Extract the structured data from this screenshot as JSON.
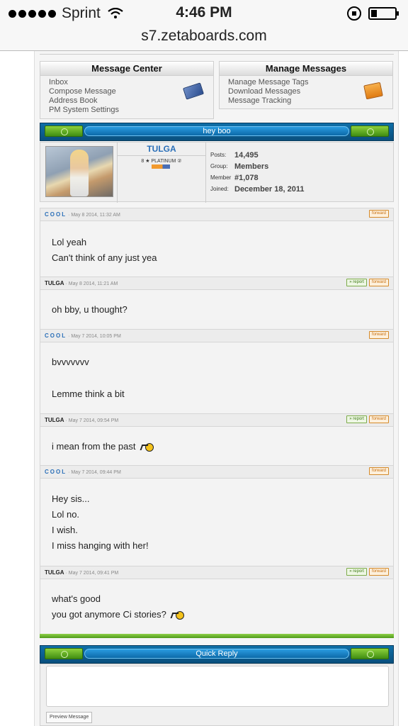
{
  "status_bar": {
    "carrier": "Sprint",
    "time": "4:46 PM"
  },
  "address_bar": {
    "url": "s7.zetaboards.com"
  },
  "message_center": {
    "title": "Message Center",
    "items": [
      "Inbox",
      "Compose Message",
      "Address Book",
      "PM System Settings"
    ],
    "icon": "envelope-icon"
  },
  "manage_messages": {
    "title": "Manage Messages",
    "items": [
      "Manage Message Tags",
      "Download Messages",
      "Message Tracking"
    ],
    "icon": "folder-icon"
  },
  "thread": {
    "title": "hey boo"
  },
  "profile": {
    "name": "TULGA",
    "rank": "8 ★ PLATINUM ②",
    "stats": [
      {
        "label": "Posts:",
        "value": "14,495"
      },
      {
        "label": "Group:",
        "value": "Members"
      },
      {
        "label": "Member",
        "value": "#1,078"
      },
      {
        "label": "Joined:",
        "value": "December 18, 2011"
      }
    ]
  },
  "buttons": {
    "report": "» report",
    "forward": "forward"
  },
  "posts": [
    {
      "author": "COOL",
      "date": "· May 8 2014, 11:32 AM",
      "lines": [
        "Lol yeah",
        "Can't think of any just yea"
      ]
    },
    {
      "author": "TULGA",
      "date": "· May 8 2014, 11:21 AM",
      "lines": [
        "oh bby, u thought?"
      ]
    },
    {
      "author": "COOL",
      "date": "· May 7 2014, 10:05 PM",
      "lines": [
        "bvvvvvvv",
        "Lemme think a bit"
      ]
    },
    {
      "author": "TULGA",
      "date": "· May 7 2014, 09:54 PM",
      "lines": [
        "i mean from the past"
      ]
    },
    {
      "author": "COOL",
      "date": "· May 7 2014, 09:44 PM",
      "lines": [
        "Hey sis...",
        "Lol no.",
        "I wish.",
        "I miss hanging with her!"
      ]
    },
    {
      "author": "TULGA",
      "date": "· May 7 2014, 09:41 PM",
      "lines": [
        "what's good",
        "you got anymore Ci stories?"
      ]
    }
  ],
  "quick_reply": {
    "title": "Quick Reply",
    "preview_button": "Preview Message"
  }
}
